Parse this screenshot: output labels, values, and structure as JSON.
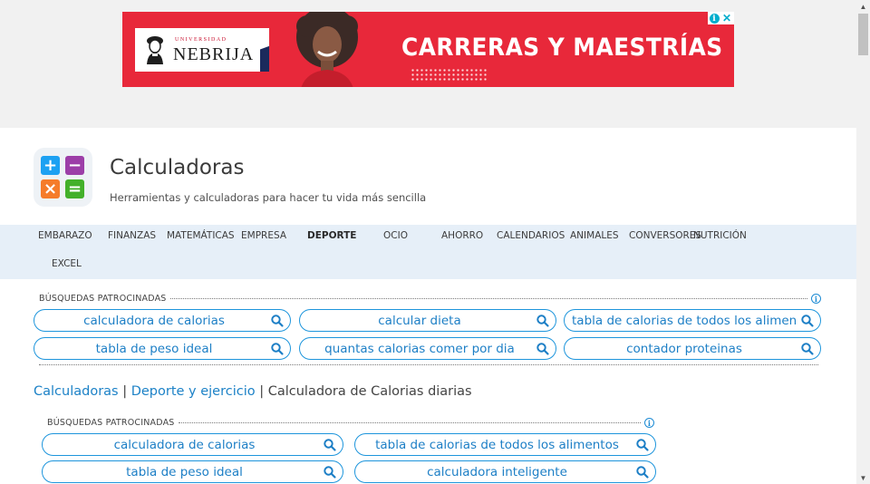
{
  "ad": {
    "logo_small": "UNIVERSIDAD",
    "logo_big": "NEBRIJA",
    "headline": "CARRERAS Y MAESTRÍAS",
    "info_icon": "info-icon",
    "close_icon": "close-icon",
    "brand_red": "#e8283a"
  },
  "site": {
    "title": "Calculadoras",
    "subtitle": "Herramientas y calculadoras para hacer tu vida más sencilla",
    "logo_tiles": [
      "+",
      "−",
      "×",
      "="
    ],
    "logo_colors": [
      "#1da1f2",
      "#9c3ea8",
      "#f57c2a",
      "#43b02a"
    ]
  },
  "nav": {
    "items": [
      "EMBARAZO",
      "FINANZAS",
      "MATEMÁTICAS",
      "EMPRESA",
      "DEPORTE",
      "OCIO",
      "AHORRO",
      "CALENDARIOS",
      "ANIMALES",
      "CONVERSORES",
      "NUTRICIÓN",
      "EXCEL"
    ],
    "active": "DEPORTE"
  },
  "sponsored_top": {
    "label": "BÚSQUEDAS PATROCINADAS",
    "pills": [
      "calculadora de calorias",
      "calcular dieta",
      "tabla de calorias de todos los alimentos",
      "tabla de peso ideal",
      "quantas calorias comer por dia",
      "contador proteinas"
    ]
  },
  "breadcrumb": {
    "home": "Calculadoras",
    "sep": "|",
    "section": "Deporte y ejercicio",
    "current": "Calculadora de Calorias diarias"
  },
  "sponsored_bottom": {
    "label": "BÚSQUEDAS PATROCINADAS",
    "pills": [
      "calculadora de calorias",
      "tabla de calorias de todos los alimentos",
      "tabla de peso ideal",
      "calculadora inteligente"
    ]
  },
  "accent_color": "#1d95dc"
}
